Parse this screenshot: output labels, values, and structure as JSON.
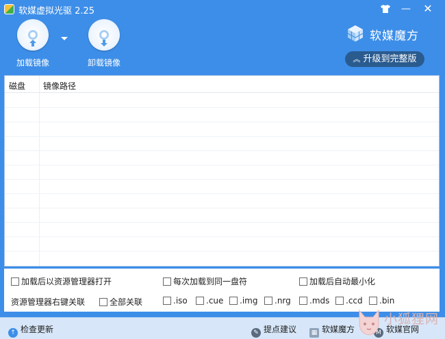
{
  "window": {
    "title": "软媒虚拟光驱 2.25",
    "title_buttons": {
      "skin_icon": "shirt-icon",
      "minimize": "—",
      "close": "✕"
    }
  },
  "toolbar": {
    "mount_label": "加载镜像",
    "unmount_label": "卸载镜像"
  },
  "brand": {
    "name": "软媒魔方",
    "upgrade_label": "升级到完整版",
    "upgrade_chevron": "≈"
  },
  "table": {
    "columns": [
      "磁盘",
      "镜像路径"
    ],
    "rows": []
  },
  "options": {
    "open_explorer_after_mount": "加载后以资源管理器打开",
    "same_drive_each_time": "每次加载到同一盘符",
    "minimize_after_mount": "加载后自动最小化",
    "context_menu_label": "资源管理器右键关联",
    "associate_all": "全部关联",
    "extensions": [
      ".iso",
      ".cue",
      ".img",
      ".nrg",
      ".mds",
      ".ccd",
      ".bin"
    ]
  },
  "statusbar": {
    "check_update": "检查更新",
    "feedback": "提点建议",
    "mofang": "软媒魔方",
    "website": "软媒官网"
  },
  "watermark": {
    "text": "小狐狸网",
    "url": ""
  },
  "colors": {
    "window_blue": "#3d8ee8",
    "upgrade_button": "#2a5b8f",
    "statusbar": "#d7e7f9"
  }
}
